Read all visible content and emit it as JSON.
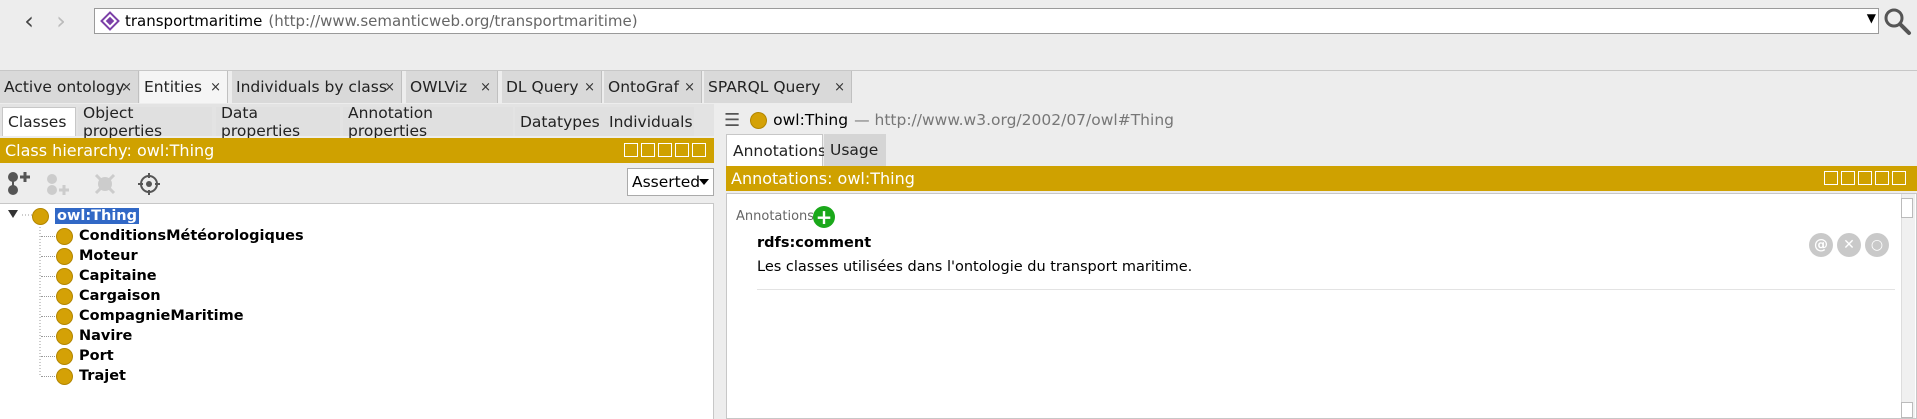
{
  "address": {
    "ontology_name": "transportmaritime",
    "ontology_uri": "(http://www.semanticweb.org/transportmaritime)"
  },
  "main_tabs": [
    {
      "label": "Active ontology"
    },
    {
      "label": "Entities"
    },
    {
      "label": "Individuals by class"
    },
    {
      "label": "OWLViz"
    },
    {
      "label": "DL Query"
    },
    {
      "label": "OntoGraf"
    },
    {
      "label": "SPARQL Query"
    }
  ],
  "close_glyph": "×",
  "sub_tabs": [
    {
      "label": "Classes"
    },
    {
      "label": "Object properties"
    },
    {
      "label": "Data properties"
    },
    {
      "label": "Annotation properties"
    },
    {
      "label": "Datatypes"
    },
    {
      "label": "Individuals"
    }
  ],
  "class_hierarchy": {
    "title": "Class hierarchy: owl:Thing",
    "view_mode": "Asserted",
    "root": "owl:Thing",
    "children": [
      "ConditionsMétéorologiques",
      "Moteur",
      "Capitaine",
      "Cargaison",
      "CompagnieMaritime",
      "Navire",
      "Port",
      "Trajet"
    ]
  },
  "entity_header": {
    "name": "owl:Thing",
    "uri": "— http://www.w3.org/2002/07/owl#Thing"
  },
  "right_tabs": [
    {
      "label": "Annotations"
    },
    {
      "label": "Usage"
    }
  ],
  "annotations_panel": {
    "title": "Annotations: owl:Thing",
    "section_label": "Annotations:",
    "property": "rdfs:comment",
    "value": "Les classes utilisées dans l'ontologie du transport maritime."
  },
  "colors": {
    "accent_bar": "#cfa100",
    "class_dot": "#d4a106",
    "selection": "#3168c6",
    "add_button": "#1aa81a"
  }
}
